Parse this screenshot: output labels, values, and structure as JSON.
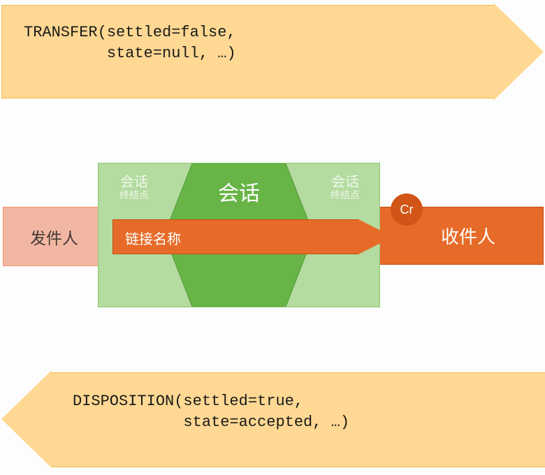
{
  "top_arrow": {
    "text": "TRANSFER(settled=false,\n         state=null, …)"
  },
  "bottom_arrow": {
    "text": "DISPOSITION(settled=true,\n            state=accepted, …)"
  },
  "sender": {
    "label": "发件人"
  },
  "receiver": {
    "label": "收件人"
  },
  "session": {
    "title": "会话",
    "endpoint_left_line1": "会话",
    "endpoint_left_line2": "终结点",
    "endpoint_right_line1": "会话",
    "endpoint_right_line2": "终结点",
    "link_label": "链接名称"
  },
  "credit_badge": {
    "label": "Cr"
  },
  "colors": {
    "arrow_fill": "#ffd893",
    "arrow_border": "#f3bb4f",
    "sender_fill": "#f2b7a3",
    "receiver_fill": "#e76b28",
    "session_fill": "#b4dba0",
    "session_center_fill": "#68b447",
    "credit_fill": "#d25518"
  }
}
